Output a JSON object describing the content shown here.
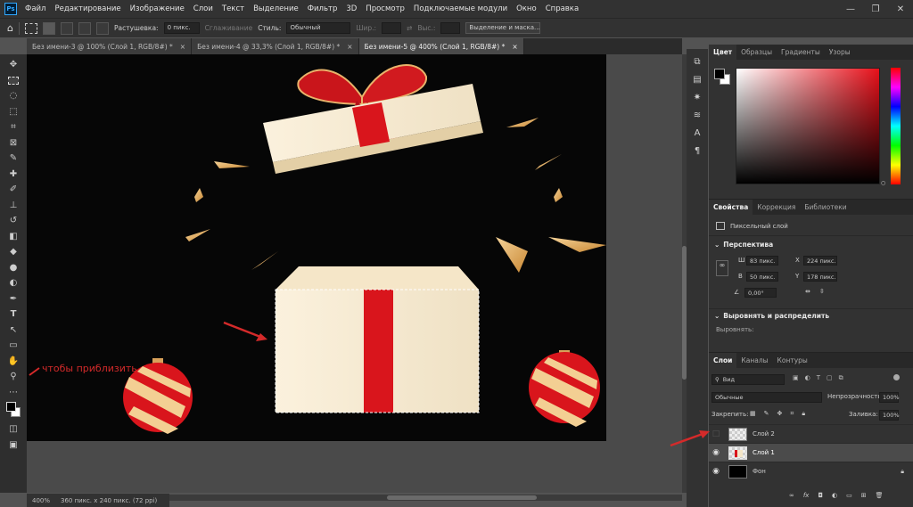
{
  "app": {
    "logo": "Ps"
  },
  "menu": [
    "Файл",
    "Редактирование",
    "Изображение",
    "Слои",
    "Текст",
    "Выделение",
    "Фильтр",
    "3D",
    "Просмотр",
    "Подключаемые модули",
    "Окно",
    "Справка"
  ],
  "window_controls": {
    "minimize": "—",
    "maximize": "❐",
    "close": "✕"
  },
  "options_bar": {
    "feather_label": "Растушевка:",
    "feather_value": "0 пикс.",
    "antialias_label": "Сглаживание",
    "style_label": "Стиль:",
    "style_value": "Обычный",
    "width_label": "Шир.:",
    "height_label": "Выс.:",
    "select_mask_button": "Выделение и маска..."
  },
  "tabs": [
    {
      "label": "Без имени-3 @ 100% (Слой 1, RGB/8#) *",
      "active": false
    },
    {
      "label": "Без имени-4 @ 33,3% (Слой 1, RGB/8#) *",
      "active": false
    },
    {
      "label": "Без имени-5 @ 400% (Слой 1, RGB/8#) *",
      "active": true
    }
  ],
  "tab_close": "×",
  "status": {
    "zoom": "400%",
    "doc_info": "360 пикс. x 240 пикс. (72 ppi)"
  },
  "annotations": {
    "zoom_hint": "чтобы приблизить",
    "annotation_color": "#d42a2a"
  },
  "color_panel": {
    "tabs": [
      "Цвет",
      "Образцы",
      "Градиенты",
      "Узоры"
    ],
    "active_tab": "Цвет",
    "hue_color": "#e8101a"
  },
  "properties_panel": {
    "tabs": [
      "Свойства",
      "Коррекция",
      "Библиотеки"
    ],
    "active_tab": "Свойства",
    "layer_type": "Пиксельный слой",
    "transform_section": "Перспектива",
    "w_label": "Ш",
    "w_value": "83 пикс.",
    "h_label": "В",
    "h_value": "50 пикс.",
    "x_label": "X",
    "x_value": "224 пикс.",
    "y_label": "Y",
    "y_value": "178 пикс.",
    "angle_value": "0,00°",
    "align_section": "Выровнять и распределить",
    "align_label": "Выровнять:"
  },
  "layers_panel": {
    "tabs": [
      "Слои",
      "Каналы",
      "Контуры"
    ],
    "active_tab": "Слои",
    "filter_value": "Вид",
    "blend_mode": "Обычные",
    "opacity_label": "Непрозрачность:",
    "opacity_value": "100%",
    "lock_label": "Закрепить:",
    "fill_label": "Заливка:",
    "fill_value": "100%",
    "layers": [
      {
        "name": "Слой 2",
        "visible": false,
        "selected": false,
        "thumb": "checker"
      },
      {
        "name": "Слой 1",
        "visible": true,
        "selected": true,
        "thumb": "checker-object"
      },
      {
        "name": "Фон",
        "visible": true,
        "selected": false,
        "thumb": "black",
        "locked": true
      }
    ],
    "footer_icons": [
      "link-icon",
      "fx-icon",
      "mask-icon",
      "adjustment-icon",
      "group-icon",
      "new-layer-icon",
      "trash-icon"
    ]
  }
}
